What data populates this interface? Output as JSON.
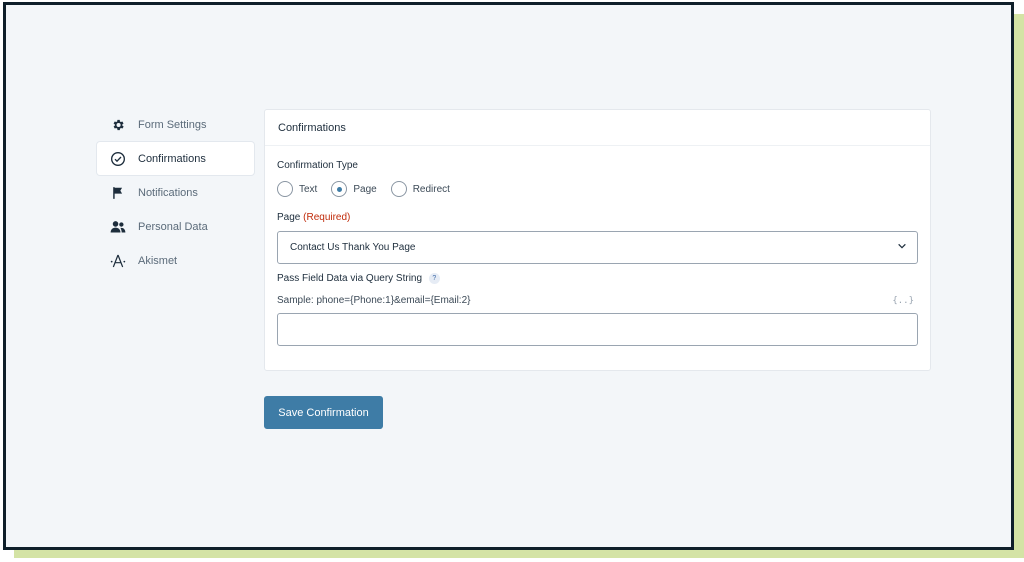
{
  "sidebar": {
    "items": [
      {
        "label": "Form Settings",
        "icon": "gear-icon",
        "active": false
      },
      {
        "label": "Confirmations",
        "icon": "check-circle-icon",
        "active": true
      },
      {
        "label": "Notifications",
        "icon": "flag-icon",
        "active": false
      },
      {
        "label": "Personal Data",
        "icon": "users-icon",
        "active": false
      },
      {
        "label": "Akismet",
        "icon": "akismet-icon",
        "active": false
      }
    ]
  },
  "card": {
    "title": "Confirmations",
    "confirmation_type_label": "Confirmation Type",
    "radio_options": [
      {
        "label": "Text",
        "checked": false
      },
      {
        "label": "Page",
        "checked": true
      },
      {
        "label": "Redirect",
        "checked": false
      }
    ],
    "page_label": "Page",
    "required_text": "(Required)",
    "page_value": "Contact Us Thank You Page",
    "query_label": "Pass Field Data via Query String",
    "help_mark": "?",
    "sample_text": "Sample: phone={Phone:1}&email={Email:2}",
    "merge_tag_symbol": "{..}",
    "query_value": ""
  },
  "save_button_label": "Save Confirmation",
  "colors": {
    "accent": "#3e7ca6",
    "required": "#c02b0a",
    "background": "#f3f6f9",
    "frame_border": "#0f1f2a",
    "shadow": "#d4e3a5"
  }
}
